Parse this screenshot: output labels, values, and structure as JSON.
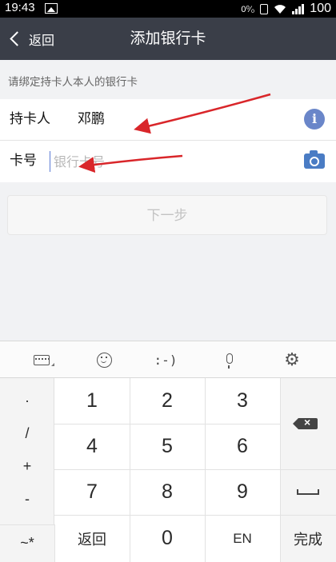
{
  "status_bar": {
    "time": "19:43",
    "data_speed": "0⁰⁄₀",
    "battery": "100"
  },
  "nav": {
    "back_label": "返回",
    "title": "添加银行卡"
  },
  "hint": "请绑定持卡人本人的银行卡",
  "form": {
    "holder_label": "持卡人",
    "holder_value": "邓鹏",
    "card_label": "卡号",
    "card_placeholder": "银行卡号"
  },
  "next_button": "下一步",
  "keyboard": {
    "toolbar": {
      "emoticon": ":-)"
    },
    "symbols": [
      "·",
      "/",
      "+",
      "-"
    ],
    "digits": [
      "1",
      "2",
      "3",
      "4",
      "5",
      "6",
      "7",
      "8",
      "9"
    ],
    "zero": "0",
    "bottom_left": "~*",
    "return_label": "返回",
    "lang_label": "EN",
    "done_label": "完成"
  },
  "accent_colors": {
    "navbar": "#3a3e48",
    "info_icon": "#6a86c9",
    "camera_icon": "#4a7cc4",
    "annotation_arrow": "#d9262a"
  }
}
